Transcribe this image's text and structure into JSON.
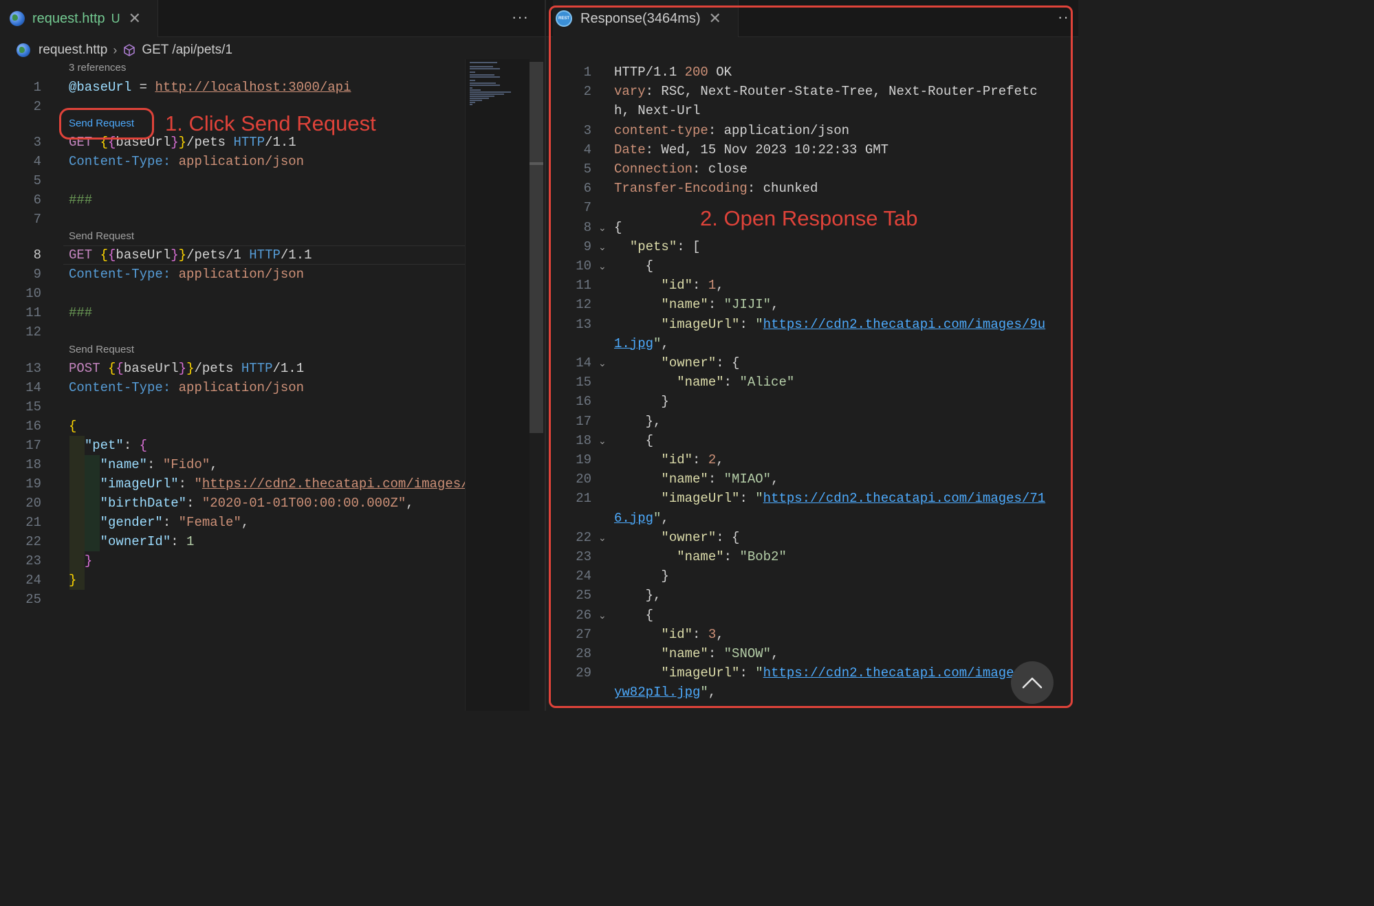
{
  "left_tab": {
    "name": "request.http",
    "status": "U"
  },
  "breadcrumb": {
    "file": "request.http",
    "symbol": "GET /api/pets/1"
  },
  "lenses": {
    "references": "3 references",
    "send_request": "Send Request"
  },
  "left_lines": [
    {
      "n": "1",
      "tokens": [
        {
          "c": "t-var",
          "t": "@baseUrl"
        },
        {
          "c": "t-plain",
          "t": " = "
        },
        {
          "c": "t-url",
          "t": "http://localhost:3000/api"
        }
      ]
    },
    {
      "n": "2",
      "tokens": []
    },
    {
      "n": "3",
      "tokens": [
        {
          "c": "t-method",
          "t": "GET "
        },
        {
          "c": "t-brace",
          "t": "{"
        },
        {
          "c": "t-brace2",
          "t": "{"
        },
        {
          "c": "t-plain",
          "t": "baseUrl"
        },
        {
          "c": "t-brace2",
          "t": "}"
        },
        {
          "c": "t-brace",
          "t": "}"
        },
        {
          "c": "t-plain",
          "t": "/pets "
        },
        {
          "c": "t-proto",
          "t": "HTTP"
        },
        {
          "c": "t-plain",
          "t": "/1.1"
        }
      ]
    },
    {
      "n": "4",
      "tokens": [
        {
          "c": "t-hdr",
          "t": "Content-Type: "
        },
        {
          "c": "t-str",
          "t": "application/json"
        }
      ]
    },
    {
      "n": "5",
      "tokens": []
    },
    {
      "n": "6",
      "tokens": [
        {
          "c": "t-comment",
          "t": "###"
        }
      ]
    },
    {
      "n": "7",
      "tokens": []
    },
    {
      "n": "8",
      "tokens": [
        {
          "c": "t-method",
          "t": "GET "
        },
        {
          "c": "t-brace",
          "t": "{"
        },
        {
          "c": "t-brace2",
          "t": "{"
        },
        {
          "c": "t-plain",
          "t": "baseUrl"
        },
        {
          "c": "t-brace2",
          "t": "}"
        },
        {
          "c": "t-brace",
          "t": "}"
        },
        {
          "c": "t-plain",
          "t": "/pets/1 "
        },
        {
          "c": "t-proto",
          "t": "HTTP"
        },
        {
          "c": "t-plain",
          "t": "/1.1"
        }
      ]
    },
    {
      "n": "9",
      "tokens": [
        {
          "c": "t-hdr",
          "t": "Content-Type: "
        },
        {
          "c": "t-str",
          "t": "application/json"
        }
      ]
    },
    {
      "n": "10",
      "tokens": []
    },
    {
      "n": "11",
      "tokens": [
        {
          "c": "t-comment",
          "t": "###"
        }
      ]
    },
    {
      "n": "12",
      "tokens": []
    },
    {
      "n": "13",
      "tokens": [
        {
          "c": "t-method",
          "t": "POST "
        },
        {
          "c": "t-brace",
          "t": "{"
        },
        {
          "c": "t-brace2",
          "t": "{"
        },
        {
          "c": "t-plain",
          "t": "baseUrl"
        },
        {
          "c": "t-brace2",
          "t": "}"
        },
        {
          "c": "t-brace",
          "t": "}"
        },
        {
          "c": "t-plain",
          "t": "/pets "
        },
        {
          "c": "t-proto",
          "t": "HTTP"
        },
        {
          "c": "t-plain",
          "t": "/1.1"
        }
      ]
    },
    {
      "n": "14",
      "tokens": [
        {
          "c": "t-hdr",
          "t": "Content-Type: "
        },
        {
          "c": "t-str",
          "t": "application/json"
        }
      ]
    },
    {
      "n": "15",
      "tokens": []
    },
    {
      "n": "16",
      "tokens": [
        {
          "c": "t-brace",
          "t": "{"
        }
      ]
    },
    {
      "n": "17",
      "tokens": [
        {
          "c": "t-plain",
          "t": "  "
        },
        {
          "c": "t-key",
          "t": "\"pet\""
        },
        {
          "c": "t-plain",
          "t": ": "
        },
        {
          "c": "t-brace2",
          "t": "{"
        }
      ]
    },
    {
      "n": "18",
      "tokens": [
        {
          "c": "t-plain",
          "t": "    "
        },
        {
          "c": "t-key",
          "t": "\"name\""
        },
        {
          "c": "t-plain",
          "t": ": "
        },
        {
          "c": "t-str",
          "t": "\"Fido\""
        },
        {
          "c": "t-plain",
          "t": ","
        }
      ]
    },
    {
      "n": "19",
      "tokens": [
        {
          "c": "t-plain",
          "t": "    "
        },
        {
          "c": "t-key",
          "t": "\"imageUrl\""
        },
        {
          "c": "t-plain",
          "t": ": "
        },
        {
          "c": "t-str",
          "t": "\""
        },
        {
          "c": "t-url",
          "t": "https://cdn2.thecatapi.com/images/"
        }
      ]
    },
    {
      "n": "20",
      "tokens": [
        {
          "c": "t-plain",
          "t": "    "
        },
        {
          "c": "t-key",
          "t": "\"birthDate\""
        },
        {
          "c": "t-plain",
          "t": ": "
        },
        {
          "c": "t-str",
          "t": "\"2020-01-01T00:00:00.000Z\""
        },
        {
          "c": "t-plain",
          "t": ","
        }
      ]
    },
    {
      "n": "21",
      "tokens": [
        {
          "c": "t-plain",
          "t": "    "
        },
        {
          "c": "t-key",
          "t": "\"gender\""
        },
        {
          "c": "t-plain",
          "t": ": "
        },
        {
          "c": "t-str",
          "t": "\"Female\""
        },
        {
          "c": "t-plain",
          "t": ","
        }
      ]
    },
    {
      "n": "22",
      "tokens": [
        {
          "c": "t-plain",
          "t": "    "
        },
        {
          "c": "t-key",
          "t": "\"ownerId\""
        },
        {
          "c": "t-plain",
          "t": ": "
        },
        {
          "c": "t-num",
          "t": "1"
        }
      ]
    },
    {
      "n": "23",
      "tokens": [
        {
          "c": "t-plain",
          "t": "  "
        },
        {
          "c": "t-brace2",
          "t": "}"
        }
      ]
    },
    {
      "n": "24",
      "tokens": [
        {
          "c": "t-brace",
          "t": "}"
        }
      ]
    },
    {
      "n": "25",
      "tokens": []
    }
  ],
  "right_tab": {
    "name": "Response(3464ms)"
  },
  "response_lines": [
    {
      "n": "1",
      "fold": false,
      "tokens": [
        {
          "c": "t-plain",
          "t": "HTTP/1.1 "
        },
        {
          "c": "t-status",
          "t": "200"
        },
        {
          "c": "t-plain",
          "t": " OK"
        }
      ]
    },
    {
      "n": "2",
      "fold": false,
      "tokens": [
        {
          "c": "t-hname",
          "t": "vary"
        },
        {
          "c": "t-plain",
          "t": ": RSC, Next-Router-State-Tree, Next-Router-Prefetc"
        }
      ]
    },
    {
      "n": "",
      "fold": false,
      "tokens": [
        {
          "c": "t-plain",
          "t": "h, Next-Url"
        }
      ]
    },
    {
      "n": "3",
      "fold": false,
      "tokens": [
        {
          "c": "t-hname",
          "t": "content-type"
        },
        {
          "c": "t-plain",
          "t": ": application/json"
        }
      ]
    },
    {
      "n": "4",
      "fold": false,
      "tokens": [
        {
          "c": "t-hname",
          "t": "Date"
        },
        {
          "c": "t-plain",
          "t": ": Wed, 15 Nov 2023 10:22:33 GMT"
        }
      ]
    },
    {
      "n": "5",
      "fold": false,
      "tokens": [
        {
          "c": "t-hname",
          "t": "Connection"
        },
        {
          "c": "t-plain",
          "t": ": close"
        }
      ]
    },
    {
      "n": "6",
      "fold": false,
      "tokens": [
        {
          "c": "t-hname",
          "t": "Transfer-Encoding"
        },
        {
          "c": "t-plain",
          "t": ": chunked"
        }
      ]
    },
    {
      "n": "7",
      "fold": false,
      "tokens": []
    },
    {
      "n": "8",
      "fold": true,
      "tokens": [
        {
          "c": "t-plain",
          "t": "{"
        }
      ]
    },
    {
      "n": "9",
      "fold": true,
      "tokens": [
        {
          "c": "t-plain",
          "t": "  "
        },
        {
          "c": "t-jkey",
          "t": "\"pets\""
        },
        {
          "c": "t-plain",
          "t": ": ["
        }
      ]
    },
    {
      "n": "10",
      "fold": true,
      "tokens": [
        {
          "c": "t-plain",
          "t": "    {"
        }
      ]
    },
    {
      "n": "11",
      "fold": false,
      "tokens": [
        {
          "c": "t-plain",
          "t": "      "
        },
        {
          "c": "t-jkey",
          "t": "\"id\""
        },
        {
          "c": "t-plain",
          "t": ": "
        },
        {
          "c": "t-jnum",
          "t": "1"
        },
        {
          "c": "t-plain",
          "t": ","
        }
      ]
    },
    {
      "n": "12",
      "fold": false,
      "tokens": [
        {
          "c": "t-plain",
          "t": "      "
        },
        {
          "c": "t-jkey",
          "t": "\"name\""
        },
        {
          "c": "t-plain",
          "t": ": "
        },
        {
          "c": "t-jstr",
          "t": "\"JIJI\""
        },
        {
          "c": "t-plain",
          "t": ","
        }
      ]
    },
    {
      "n": "13",
      "fold": false,
      "tokens": [
        {
          "c": "t-plain",
          "t": "      "
        },
        {
          "c": "t-jkey",
          "t": "\"imageUrl\""
        },
        {
          "c": "t-plain",
          "t": ": "
        },
        {
          "c": "t-jstr",
          "t": "\""
        },
        {
          "c": "t-link",
          "t": "https://cdn2.thecatapi.com/images/9u"
        }
      ]
    },
    {
      "n": "",
      "fold": false,
      "tokens": [
        {
          "c": "t-link",
          "t": "1.jpg"
        },
        {
          "c": "t-jstr",
          "t": "\""
        },
        {
          "c": "t-plain",
          "t": ","
        }
      ]
    },
    {
      "n": "14",
      "fold": true,
      "tokens": [
        {
          "c": "t-plain",
          "t": "      "
        },
        {
          "c": "t-jkey",
          "t": "\"owner\""
        },
        {
          "c": "t-plain",
          "t": ": {"
        }
      ]
    },
    {
      "n": "15",
      "fold": false,
      "tokens": [
        {
          "c": "t-plain",
          "t": "        "
        },
        {
          "c": "t-jkey",
          "t": "\"name\""
        },
        {
          "c": "t-plain",
          "t": ": "
        },
        {
          "c": "t-jstr",
          "t": "\"Alice\""
        }
      ]
    },
    {
      "n": "16",
      "fold": false,
      "tokens": [
        {
          "c": "t-plain",
          "t": "      }"
        }
      ]
    },
    {
      "n": "17",
      "fold": false,
      "tokens": [
        {
          "c": "t-plain",
          "t": "    },"
        }
      ]
    },
    {
      "n": "18",
      "fold": true,
      "tokens": [
        {
          "c": "t-plain",
          "t": "    {"
        }
      ]
    },
    {
      "n": "19",
      "fold": false,
      "tokens": [
        {
          "c": "t-plain",
          "t": "      "
        },
        {
          "c": "t-jkey",
          "t": "\"id\""
        },
        {
          "c": "t-plain",
          "t": ": "
        },
        {
          "c": "t-jnum",
          "t": "2"
        },
        {
          "c": "t-plain",
          "t": ","
        }
      ]
    },
    {
      "n": "20",
      "fold": false,
      "tokens": [
        {
          "c": "t-plain",
          "t": "      "
        },
        {
          "c": "t-jkey",
          "t": "\"name\""
        },
        {
          "c": "t-plain",
          "t": ": "
        },
        {
          "c": "t-jstr",
          "t": "\"MIAO\""
        },
        {
          "c": "t-plain",
          "t": ","
        }
      ]
    },
    {
      "n": "21",
      "fold": false,
      "tokens": [
        {
          "c": "t-plain",
          "t": "      "
        },
        {
          "c": "t-jkey",
          "t": "\"imageUrl\""
        },
        {
          "c": "t-plain",
          "t": ": "
        },
        {
          "c": "t-jstr",
          "t": "\""
        },
        {
          "c": "t-link",
          "t": "https://cdn2.thecatapi.com/images/71"
        }
      ]
    },
    {
      "n": "",
      "fold": false,
      "tokens": [
        {
          "c": "t-link",
          "t": "6.jpg"
        },
        {
          "c": "t-jstr",
          "t": "\""
        },
        {
          "c": "t-plain",
          "t": ","
        }
      ]
    },
    {
      "n": "22",
      "fold": true,
      "tokens": [
        {
          "c": "t-plain",
          "t": "      "
        },
        {
          "c": "t-jkey",
          "t": "\"owner\""
        },
        {
          "c": "t-plain",
          "t": ": {"
        }
      ]
    },
    {
      "n": "23",
      "fold": false,
      "tokens": [
        {
          "c": "t-plain",
          "t": "        "
        },
        {
          "c": "t-jkey",
          "t": "\"name\""
        },
        {
          "c": "t-plain",
          "t": ": "
        },
        {
          "c": "t-jstr",
          "t": "\"Bob2\""
        }
      ]
    },
    {
      "n": "24",
      "fold": false,
      "tokens": [
        {
          "c": "t-plain",
          "t": "      }"
        }
      ]
    },
    {
      "n": "25",
      "fold": false,
      "tokens": [
        {
          "c": "t-plain",
          "t": "    },"
        }
      ]
    },
    {
      "n": "26",
      "fold": true,
      "tokens": [
        {
          "c": "t-plain",
          "t": "    {"
        }
      ]
    },
    {
      "n": "27",
      "fold": false,
      "tokens": [
        {
          "c": "t-plain",
          "t": "      "
        },
        {
          "c": "t-jkey",
          "t": "\"id\""
        },
        {
          "c": "t-plain",
          "t": ": "
        },
        {
          "c": "t-jnum",
          "t": "3"
        },
        {
          "c": "t-plain",
          "t": ","
        }
      ]
    },
    {
      "n": "28",
      "fold": false,
      "tokens": [
        {
          "c": "t-plain",
          "t": "      "
        },
        {
          "c": "t-jkey",
          "t": "\"name\""
        },
        {
          "c": "t-plain",
          "t": ": "
        },
        {
          "c": "t-jstr",
          "t": "\"SNOW\""
        },
        {
          "c": "t-plain",
          "t": ","
        }
      ]
    },
    {
      "n": "29",
      "fold": false,
      "tokens": [
        {
          "c": "t-plain",
          "t": "      "
        },
        {
          "c": "t-jkey",
          "t": "\"imageUrl\""
        },
        {
          "c": "t-plain",
          "t": ": "
        },
        {
          "c": "t-jstr",
          "t": "\""
        },
        {
          "c": "t-link",
          "t": "https://cdn2.thecatapi.com/image"
        }
      ]
    },
    {
      "n": "",
      "fold": false,
      "tokens": [
        {
          "c": "t-link",
          "t": "yw82pIl.jpg"
        },
        {
          "c": "t-jstr",
          "t": "\""
        },
        {
          "c": "t-plain",
          "t": ","
        }
      ]
    }
  ],
  "annotations": {
    "step1": "1. Click Send Request",
    "step2": "2. Open Response Tab"
  },
  "colors": {
    "annotation": "#e0433a",
    "modified_tab": "#73c991",
    "link": "#4daafc"
  },
  "icons": {
    "file": "http-globe-icon",
    "symbol": "cube-icon",
    "response": "rest-client-icon",
    "close": "close-icon",
    "more": "more-actions-icon",
    "scroll_top": "chevron-up-icon"
  }
}
